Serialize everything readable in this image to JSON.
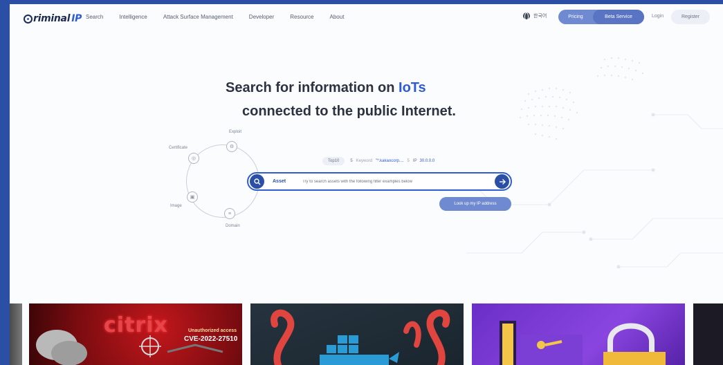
{
  "brand": {
    "logo_main": "riminal",
    "logo_ip": "IP"
  },
  "nav": {
    "menu": [
      "Search",
      "Intelligence",
      "Attack Surface Management",
      "Developer",
      "Resource",
      "About"
    ],
    "language": "한국어",
    "pricing": "Pricing",
    "beta_service": "Beta Service",
    "login": "Login",
    "register": "Register"
  },
  "hero": {
    "line1_prefix": "Search for information on ",
    "line1_highlight": "IoTs",
    "line2": "connected to the public Internet."
  },
  "diagram": {
    "nodes": [
      "Exploit",
      "Certificate",
      "Image",
      "Domain"
    ]
  },
  "quick_search": {
    "tag": "Top10",
    "count1": "5",
    "keyword_label": "Keyword",
    "keyword_value": "\"*.kakaocorp....",
    "count2": "5",
    "ip_label": "IP",
    "ip_value": "30.0.0.0"
  },
  "search": {
    "category": "Asset",
    "placeholder": "Try to search assets with the following filter examples below"
  },
  "lookup_button": "Look up my IP address",
  "cards": {
    "card1_word": "citrix",
    "card1_note": "Unauthorized access",
    "card1_cve": "CVE-2022-27510"
  },
  "colors": {
    "brand_blue": "#2f5bd3",
    "dark_blue": "#2a4fa5",
    "pill_blue": "#6f8ad0",
    "text_dark": "#2c3240"
  }
}
